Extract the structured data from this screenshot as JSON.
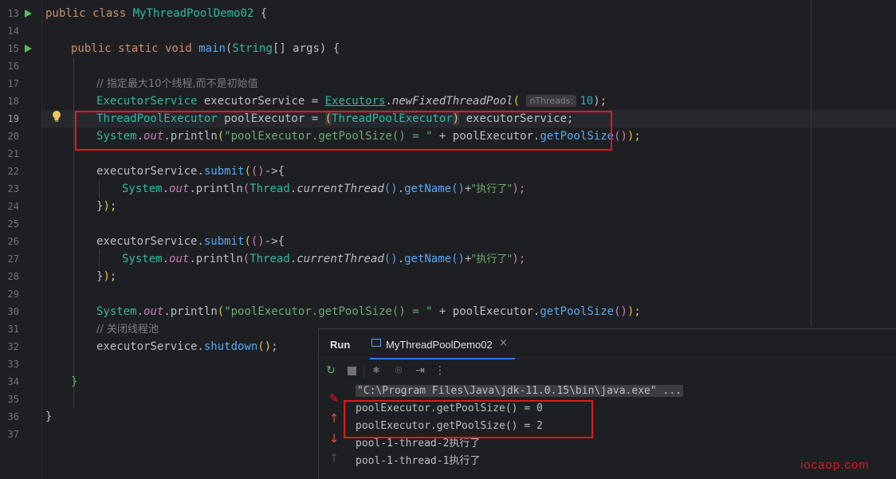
{
  "editor": {
    "line_numbers": [
      "13",
      "14",
      "15",
      "16",
      "17",
      "18",
      "19",
      "20",
      "21",
      "22",
      "23",
      "24",
      "25",
      "26",
      "27",
      "28",
      "29",
      "30",
      "31",
      "32",
      "33",
      "34",
      "35",
      "36",
      "37"
    ],
    "code": {
      "l13": {
        "kw": "public class ",
        "cls": "MyThreadPoolDemo02",
        "rest": " {"
      },
      "l15": {
        "kw": "public static void ",
        "fn": "main",
        "p1": "(",
        "type": "String",
        "rest": "[] args) {"
      },
      "l17": {
        "comment": "// 指定最大10个线程,而不是初始值"
      },
      "l18": {
        "type": "ExecutorService",
        "var": " executorService = ",
        "cls2": "Executors",
        "dot": ".",
        "method": "newFixedThreadPool",
        "open": "(",
        "hint": "nThreads:",
        "num": "10",
        "close": ");"
      },
      "l19": {
        "type": "ThreadPoolExecutor",
        "var": " poolExecutor = ",
        "castopen": "(",
        "casttype": "ThreadPoolExecutor",
        "castclose": ")",
        "rest": " executorService;"
      },
      "l20": {
        "cls": "System",
        "dot1": ".",
        "fld": "out",
        "dot2": ".",
        "fn": "println",
        "open": "(",
        "str": "\"poolExecutor.getPoolSize() = \"",
        "plus": " + poolExecutor.",
        "fn2": "getPoolSize",
        "parens": "()",
        "close": ");"
      },
      "l22": {
        "var": "executorService.",
        "fn": "submit",
        "open": "(",
        "lam": "()",
        "arrow": "->{"
      },
      "l23": {
        "cls": "System",
        "dot1": ".",
        "fld": "out",
        "dot2": ".",
        "fn": "println",
        "open": "(",
        "cls2": "Thread",
        "dot3": ".",
        "method": "currentThread",
        "p": "()",
        "dot4": ".",
        "fn2": "getName",
        "p2": "()",
        "plus": "+",
        "str": "\"执行了\"",
        "close": ");"
      },
      "l24": {
        "brace": "}",
        "close": ");"
      },
      "l26": {
        "var": "executorService.",
        "fn": "submit",
        "open": "(",
        "lam": "()",
        "arrow": "->{"
      },
      "l27": {
        "cls": "System",
        "dot1": ".",
        "fld": "out",
        "dot2": ".",
        "fn": "println",
        "open": "(",
        "cls2": "Thread",
        "dot3": ".",
        "method": "currentThread",
        "p": "()",
        "dot4": ".",
        "fn2": "getName",
        "p2": "()",
        "plus": "+",
        "str": "\"执行了\"",
        "close": ");"
      },
      "l28": {
        "brace": "}",
        "close": ");"
      },
      "l30": {
        "cls": "System",
        "dot1": ".",
        "fld": "out",
        "dot2": ".",
        "fn": "println",
        "open": "(",
        "str": "\"poolExecutor.getPoolSize() = \"",
        "plus": " + poolExecutor.",
        "fn2": "getPoolSize",
        "parens": "()",
        "close": ");"
      },
      "l31": {
        "comment": "// 关闭线程池"
      },
      "l32": {
        "var": "executorService.",
        "fn": "shutdown",
        "parens": "()",
        "close": ";"
      },
      "l34": {
        "text": "}"
      },
      "l36": {
        "text": "}"
      }
    }
  },
  "run_panel": {
    "title": "Run",
    "tab_label": "MyThreadPoolDemo02",
    "tab_close": "×",
    "toolbar_icons": [
      "rerun-icon",
      "stop-icon",
      "debug-icon",
      "screenshot-icon",
      "exit-icon",
      "more-icon"
    ],
    "console_lines": [
      "\"C:\\Program Files\\Java\\jdk-11.0.15\\bin\\java.exe\" ...",
      "poolExecutor.getPoolSize() = 0",
      "poolExecutor.getPoolSize() = 2",
      "pool-1-thread-2执行了",
      "pool-1-thread-1执行了"
    ]
  },
  "watermark": "iocaop.com",
  "colors": {
    "accent": "#3574f0",
    "highlight_box": "#e0191e",
    "run_icon": "#5fb865"
  }
}
